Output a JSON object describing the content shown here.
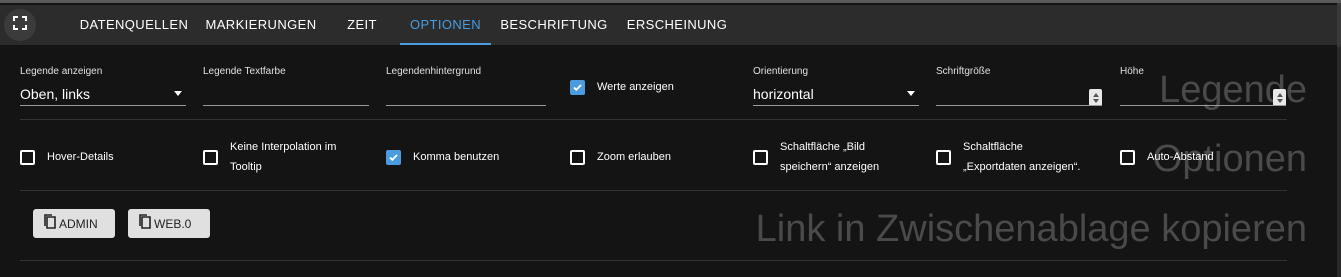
{
  "tabs": [
    {
      "label": "DATENQUELLEN",
      "active": false
    },
    {
      "label": "MARKIERUNGEN",
      "active": false
    },
    {
      "label": "ZEIT",
      "active": false
    },
    {
      "label": "OPTIONEN",
      "active": true
    },
    {
      "label": "BESCHRIFTUNG",
      "active": false
    },
    {
      "label": "ERSCHEINUNG",
      "active": false
    }
  ],
  "background_labels": {
    "legend": "Legende",
    "options": "Optionen",
    "link": "Link in Zwischenablage kopieren"
  },
  "legend_fields": {
    "show_legend": {
      "label": "Legende anzeigen",
      "value": "Oben, links"
    },
    "text_color": {
      "label": "Legende Textfarbe",
      "value": ""
    },
    "background": {
      "label": "Legendenhintergrund",
      "value": ""
    },
    "show_values": {
      "label": "Werte anzeigen",
      "checked": true
    },
    "orientation": {
      "label": "Orientierung",
      "value": "horizontal"
    },
    "font_size": {
      "label": "Schriftgröße",
      "value": ""
    },
    "height": {
      "label": "Höhe",
      "value": ""
    }
  },
  "options": [
    {
      "label": "Hover-Details",
      "checked": false
    },
    {
      "label": "Keine Interpolation im\nTooltip",
      "checked": false
    },
    {
      "label": "Komma benutzen",
      "checked": true
    },
    {
      "label": "Zoom erlauben",
      "checked": false
    },
    {
      "label": "Schaltfläche „Bild\nspeichern“ anzeigen",
      "checked": false
    },
    {
      "label": "Schaltfläche\n„Exportdaten anzeigen“.",
      "checked": false
    },
    {
      "label": "Auto-Abstand",
      "checked": false
    }
  ],
  "link_buttons": {
    "admin": "ADMIN",
    "web": "WEB.0"
  },
  "colors": {
    "accent": "#4a9be0",
    "background": "#141414",
    "appbar": "#2c2c2c"
  },
  "icons": {
    "fullscreen": "fullscreen-icon",
    "copy": "copy-icon",
    "check": "check-icon"
  }
}
